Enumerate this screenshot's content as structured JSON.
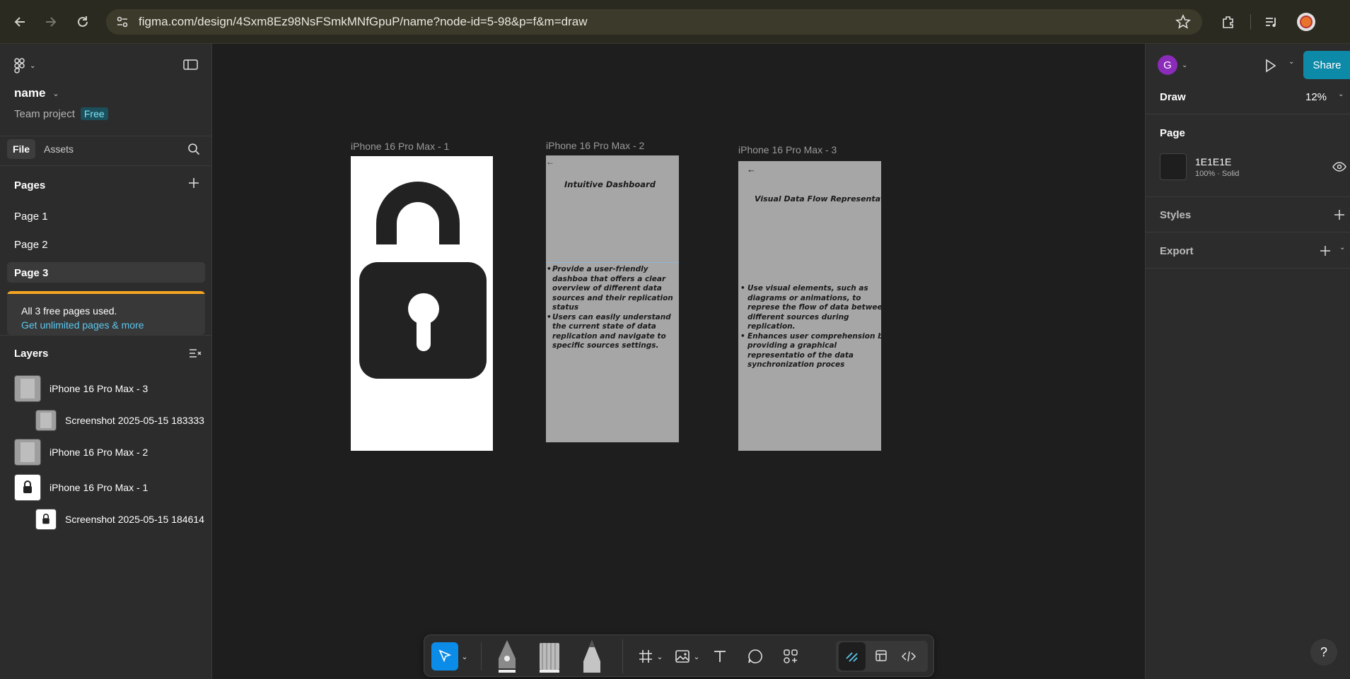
{
  "browser": {
    "url": "figma.com/design/4Sxm8Ez98NsFSmkMNfGpuP/name?node-id=5-98&p=f&m=draw"
  },
  "left_panel": {
    "file_name": "name",
    "team_label": "Team project",
    "plan_badge": "Free",
    "tabs": {
      "file": "File",
      "assets": "Assets"
    },
    "pages_title": "Pages",
    "pages": [
      {
        "label": "Page 1"
      },
      {
        "label": "Page 2"
      },
      {
        "label": "Page 3"
      }
    ],
    "notice": {
      "text": "All 3 free pages used.",
      "link": "Get unlimited pages & more"
    },
    "layers_title": "Layers",
    "layers": [
      {
        "label": "iPhone 16 Pro Max - 3"
      },
      {
        "label": "Screenshot 2025-05-15 183333"
      },
      {
        "label": "iPhone 16 Pro Max - 2"
      },
      {
        "label": "iPhone 16 Pro Max - 1"
      },
      {
        "label": "Screenshot 2025-05-15 184614"
      }
    ]
  },
  "canvas": {
    "frames": [
      {
        "label": "iPhone 16 Pro Max - 1"
      },
      {
        "label": "iPhone 16 Pro Max - 2",
        "heading": "Intuitive Dashboard",
        "bullets": [
          "Provide a user-friendly dashboa that offers a clear overview of different data sources and their replication status",
          "Users can easily understand the current state of data replication and navigate to specific sources settings."
        ]
      },
      {
        "label": "iPhone 16 Pro Max - 3",
        "back_arrow": "←",
        "heading": "Visual Data Flow Representation",
        "bullets": [
          "Use visual elements, such as diagrams or animations, to represe the flow of data between different sources during replication.",
          "Enhances user comprehension by providing a graphical representatio of the data synchronization proces"
        ]
      }
    ]
  },
  "right_panel": {
    "avatar_letter": "G",
    "share_label": "Share",
    "mode_label": "Draw",
    "zoom": "12%",
    "page_section": "Page",
    "fill_hex": "1E1E1E",
    "fill_meta": "100% · Solid",
    "styles_label": "Styles",
    "export_label": "Export",
    "help": "?"
  },
  "colors": {
    "accent": "#0c8ce9",
    "share_bg": "#0d8aa8",
    "badge_bg": "#1b4f5c",
    "badge_text": "#7ee3f5",
    "notice_bar": "#f5a623",
    "link": "#5cc8f0",
    "frame_gray": "#a6a6a6"
  }
}
